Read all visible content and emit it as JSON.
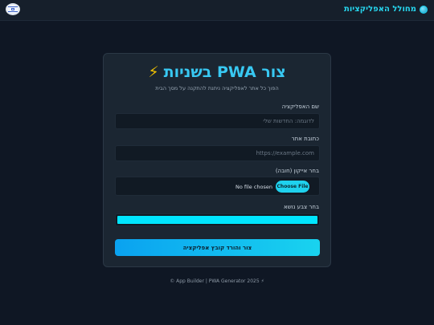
{
  "header": {
    "brand_label": "מחולל האפליקציות",
    "brand_icon": "globe-icon",
    "flag_icon": "israel-flag-icon"
  },
  "card": {
    "title": "צור PWA בשניות",
    "title_icon": "lightning-icon",
    "title_icon_glyph": "⚡",
    "subtitle": "הפוך כל אתר לאפליקציה ניתנת להתקנה על מסך הבית",
    "app_name": {
      "label": "שם האפליקציה",
      "placeholder": "לדוגמה: החדשות שלי",
      "value": ""
    },
    "site_url": {
      "label": "כתובת אתר",
      "placeholder": "https://example.com",
      "value": ""
    },
    "icon_upload": {
      "label": "בחר אייקון (חובה)",
      "button_label": "Choose File",
      "status_text": "No file chosen"
    },
    "theme_color": {
      "label": "בחר צבע נושא",
      "value": "#00e5ff"
    },
    "submit_label": "צור והורד קובץ אפליקציה"
  },
  "footer": {
    "text": "⚡ App Builder | PWA Generator 2025 ©"
  },
  "colors": {
    "accent": "#27d7ef",
    "background": "#0f1724",
    "card": "#1b2632",
    "bolt": "#f5c400"
  }
}
